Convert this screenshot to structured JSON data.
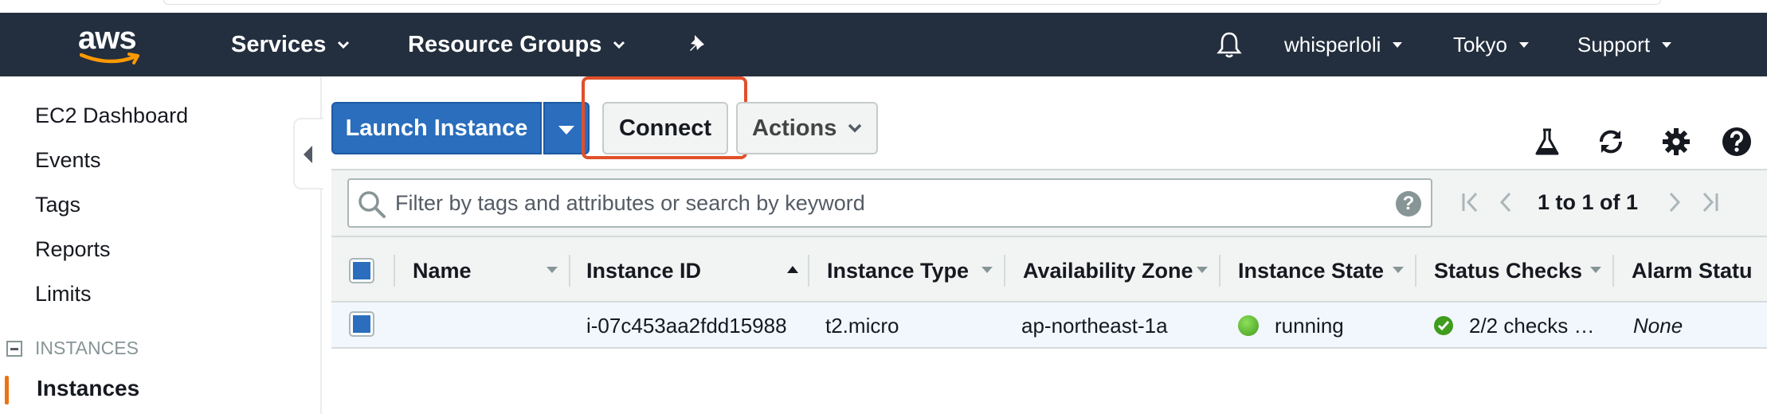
{
  "nav": {
    "logo_text": "aws",
    "services_label": "Services",
    "resource_groups_label": "Resource Groups",
    "user_label": "whisperloli",
    "region_label": "Tokyo",
    "support_label": "Support"
  },
  "sidebar": {
    "links": [
      "EC2 Dashboard",
      "Events",
      "Tags",
      "Reports",
      "Limits"
    ],
    "section_header": "INSTANCES",
    "active_item": "Instances"
  },
  "toolbar": {
    "launch_label": "Launch Instance",
    "connect_label": "Connect",
    "actions_label": "Actions"
  },
  "filter": {
    "placeholder": "Filter by tags and attributes or search by keyword",
    "help": "?"
  },
  "pagination": {
    "text": "1 to 1 of 1"
  },
  "table": {
    "columns": {
      "name": "Name",
      "instance_id": "Instance ID",
      "instance_type": "Instance Type",
      "availability_zone": "Availability Zone",
      "instance_state": "Instance State",
      "status_checks": "Status Checks",
      "alarm_status": "Alarm Statu"
    },
    "rows": [
      {
        "name": "",
        "instance_id": "i-07c453aa2fdd15988",
        "instance_type": "t2.micro",
        "availability_zone": "ap-northeast-1a",
        "instance_state": "running",
        "status_checks": "2/2 checks …",
        "alarm_status": "None"
      }
    ]
  },
  "colors": {
    "nav_bg": "#232f3e",
    "primary_blue": "#2a6ebd",
    "highlight_red": "#e0502a",
    "active_orange": "#ec7211",
    "running_green": "#3f9c1d"
  }
}
